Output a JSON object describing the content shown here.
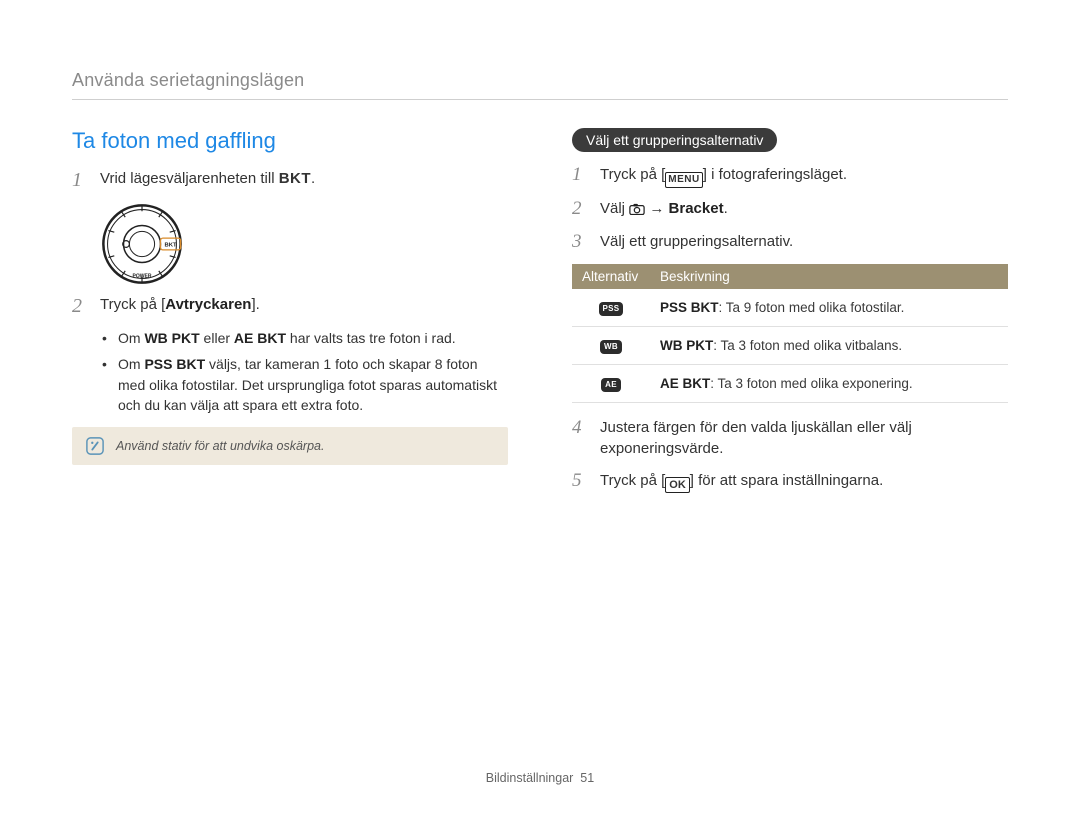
{
  "breadcrumb": "Använda serietagningslägen",
  "left": {
    "heading": "Ta foton med gaffling",
    "step1_pre": "Vrid lägesväljarenheten till ",
    "step1_bkt": "BKT",
    "step1_post": ".",
    "step2_pre": "Tryck på [",
    "step2_shutter": "Avtryckaren",
    "step2_post": "].",
    "bullet1_pre": "Om ",
    "bullet1_wb": "WB PKT",
    "bullet1_mid": " eller ",
    "bullet1_ae": "AE BKT",
    "bullet1_post": " har valts tas tre foton i rad.",
    "bullet2_pre": "Om ",
    "bullet2_pss": "PSS BKT",
    "bullet2_post": " väljs, tar kameran 1 foto och skapar 8 foton med olika fotostilar. Det ursprungliga fotot sparas automatiskt och du kan välja att spara ett extra foto.",
    "tip": "Använd stativ för att undvika oskärpa."
  },
  "right": {
    "pill": "Välj ett grupperingsalternativ",
    "step1_pre": "Tryck på [",
    "step1_menu": "MENU",
    "step1_post": "] i fotograferingsläget.",
    "step2_pre": "Välj ",
    "step2_arrow": " → ",
    "step2_bracket": "Bracket",
    "step2_post": ".",
    "step3": "Välj ett grupperingsalternativ.",
    "table": {
      "h1": "Alternativ",
      "h2": "Beskrivning",
      "rows": [
        {
          "icon": "PSS",
          "label": "PSS BKT",
          "desc": ": Ta 9 foton med olika fotostilar."
        },
        {
          "icon": "WB",
          "label": "WB PKT",
          "desc": ": Ta 3 foton med olika vitbalans."
        },
        {
          "icon": "AE",
          "label": "AE BKT",
          "desc": ": Ta 3 foton med olika exponering."
        }
      ]
    },
    "step4": "Justera färgen för den valda ljuskällan eller välj exponeringsvärde.",
    "step5_pre": "Tryck på [",
    "step5_ok": "OK",
    "step5_post": "] för att spara inställningarna."
  },
  "footer_label": "Bildinställningar",
  "footer_page": "51"
}
